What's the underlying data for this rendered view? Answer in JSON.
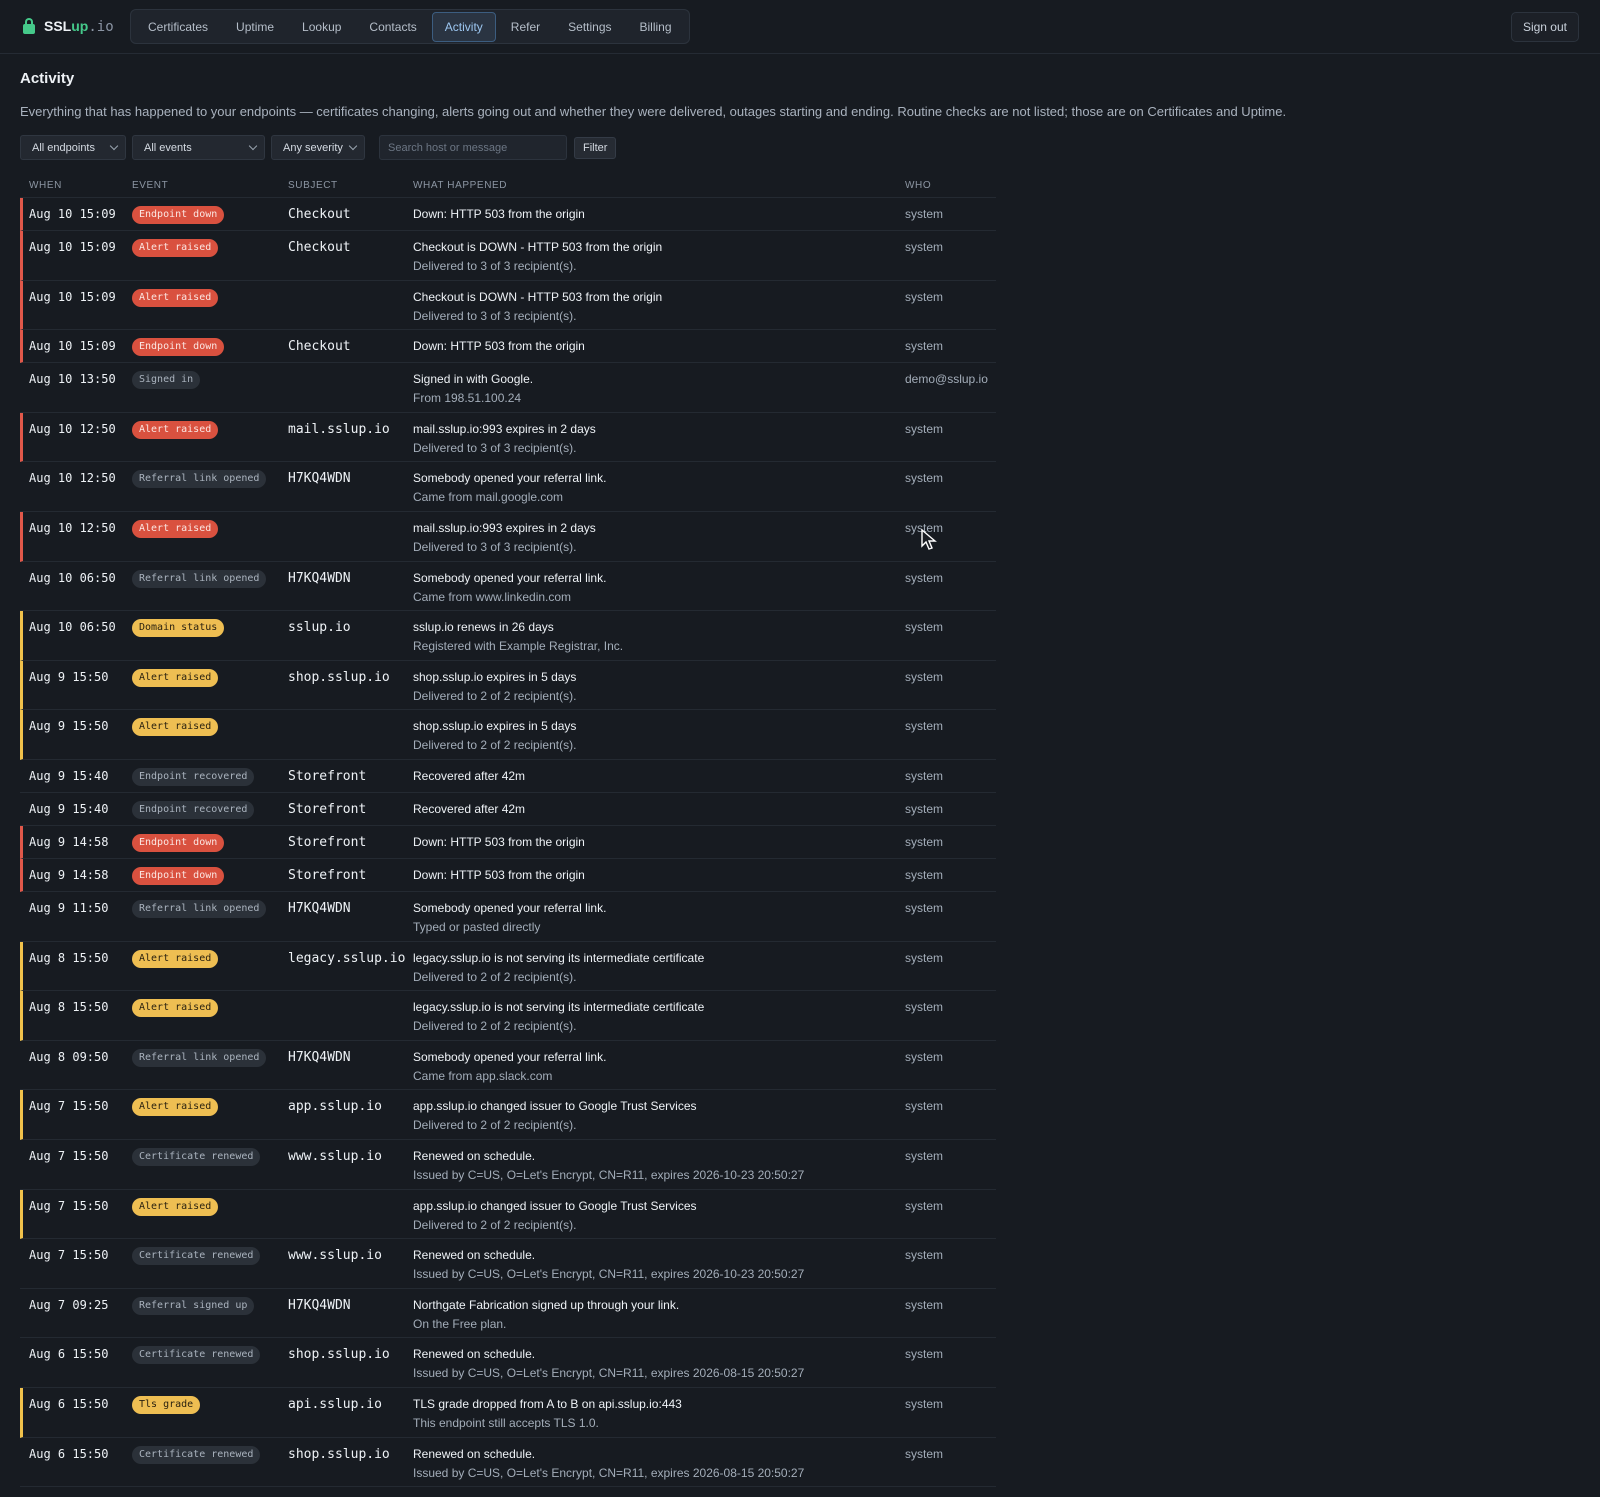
{
  "brand": {
    "name": "SSL",
    "accent": "up",
    "domain": ".io",
    "icon": "lock-icon",
    "accent_color": "#45c98a"
  },
  "nav": {
    "tabs": [
      "Certificates",
      "Uptime",
      "Lookup",
      "Contacts",
      "Activity",
      "Refer",
      "Settings",
      "Billing"
    ],
    "active": "Activity"
  },
  "sign_out": "Sign out",
  "page": {
    "title": "Activity",
    "description": "Everything that has happened to your endpoints — certificates changing, alerts going out and whether they were delivered, outages starting and ending. Routine checks are not listed; those are on Certificates and Uptime."
  },
  "filters": {
    "endpoints": "All endpoints",
    "events": "All events",
    "severity": "Any severity",
    "search_placeholder": "Search host or message",
    "search_value": "",
    "button": "Filter"
  },
  "columns": {
    "when": "WHEN",
    "event": "EVENT",
    "subject": "SUBJECT",
    "what": "WHAT HAPPENED",
    "who": "WHO"
  },
  "rows": [
    {
      "when": "Aug 10 15:09",
      "event": "Endpoint down",
      "tone": "red",
      "subject": "Checkout",
      "what": "Down: HTTP 503 from the origin",
      "detail": "",
      "who": "system"
    },
    {
      "when": "Aug 10 15:09",
      "event": "Alert raised",
      "tone": "red",
      "subject": "Checkout",
      "what": "Checkout is DOWN - HTTP 503 from the origin",
      "detail": "Delivered to 3 of 3 recipient(s).",
      "who": "system"
    },
    {
      "when": "Aug 10 15:09",
      "event": "Alert raised",
      "tone": "red",
      "subject": "",
      "what": "Checkout is DOWN - HTTP 503 from the origin",
      "detail": "Delivered to 3 of 3 recipient(s).",
      "who": "system"
    },
    {
      "when": "Aug 10 15:09",
      "event": "Endpoint down",
      "tone": "red",
      "subject": "Checkout",
      "what": "Down: HTTP 503 from the origin",
      "detail": "",
      "who": "system"
    },
    {
      "when": "Aug 10 13:50",
      "event": "Signed in",
      "tone": "gray",
      "subject": "",
      "what": "Signed in with Google.",
      "detail": "From 198.51.100.24",
      "who": "demo@sslup.io"
    },
    {
      "when": "Aug 10 12:50",
      "event": "Alert raised",
      "tone": "red",
      "subject": "mail.sslup.io",
      "what": "mail.sslup.io:993 expires in 2 days",
      "detail": "Delivered to 3 of 3 recipient(s).",
      "who": "system"
    },
    {
      "when": "Aug 10 12:50",
      "event": "Referral link opened",
      "tone": "gray",
      "subject": "H7KQ4WDN",
      "what": "Somebody opened your referral link.",
      "detail": "Came from mail.google.com",
      "who": "system"
    },
    {
      "when": "Aug 10 12:50",
      "event": "Alert raised",
      "tone": "red",
      "subject": "",
      "what": "mail.sslup.io:993 expires in 2 days",
      "detail": "Delivered to 3 of 3 recipient(s).",
      "who": "system"
    },
    {
      "when": "Aug 10 06:50",
      "event": "Referral link opened",
      "tone": "gray",
      "subject": "H7KQ4WDN",
      "what": "Somebody opened your referral link.",
      "detail": "Came from www.linkedin.com",
      "who": "system"
    },
    {
      "when": "Aug 10 06:50",
      "event": "Domain status",
      "tone": "yellow",
      "subject": "sslup.io",
      "what": "sslup.io renews in 26 days",
      "detail": "Registered with Example Registrar, Inc.",
      "who": "system"
    },
    {
      "when": "Aug 9 15:50",
      "event": "Alert raised",
      "tone": "yellow",
      "subject": "shop.sslup.io",
      "what": "shop.sslup.io expires in 5 days",
      "detail": "Delivered to 2 of 2 recipient(s).",
      "who": "system"
    },
    {
      "when": "Aug 9 15:50",
      "event": "Alert raised",
      "tone": "yellow",
      "subject": "",
      "what": "shop.sslup.io expires in 5 days",
      "detail": "Delivered to 2 of 2 recipient(s).",
      "who": "system"
    },
    {
      "when": "Aug 9 15:40",
      "event": "Endpoint recovered",
      "tone": "gray",
      "subject": "Storefront",
      "what": "Recovered after 42m",
      "detail": "",
      "who": "system"
    },
    {
      "when": "Aug 9 15:40",
      "event": "Endpoint recovered",
      "tone": "gray",
      "subject": "Storefront",
      "what": "Recovered after 42m",
      "detail": "",
      "who": "system"
    },
    {
      "when": "Aug 9 14:58",
      "event": "Endpoint down",
      "tone": "red",
      "subject": "Storefront",
      "what": "Down: HTTP 503 from the origin",
      "detail": "",
      "who": "system"
    },
    {
      "when": "Aug 9 14:58",
      "event": "Endpoint down",
      "tone": "red",
      "subject": "Storefront",
      "what": "Down: HTTP 503 from the origin",
      "detail": "",
      "who": "system"
    },
    {
      "when": "Aug 9 11:50",
      "event": "Referral link opened",
      "tone": "gray",
      "subject": "H7KQ4WDN",
      "what": "Somebody opened your referral link.",
      "detail": "Typed or pasted directly",
      "who": "system"
    },
    {
      "when": "Aug 8 15:50",
      "event": "Alert raised",
      "tone": "yellow",
      "subject": "legacy.sslup.io",
      "what": "legacy.sslup.io is not serving its intermediate certificate",
      "detail": "Delivered to 2 of 2 recipient(s).",
      "who": "system"
    },
    {
      "when": "Aug 8 15:50",
      "event": "Alert raised",
      "tone": "yellow",
      "subject": "",
      "what": "legacy.sslup.io is not serving its intermediate certificate",
      "detail": "Delivered to 2 of 2 recipient(s).",
      "who": "system"
    },
    {
      "when": "Aug 8 09:50",
      "event": "Referral link opened",
      "tone": "gray",
      "subject": "H7KQ4WDN",
      "what": "Somebody opened your referral link.",
      "detail": "Came from app.slack.com",
      "who": "system"
    },
    {
      "when": "Aug 7 15:50",
      "event": "Alert raised",
      "tone": "yellow",
      "subject": "app.sslup.io",
      "what": "app.sslup.io changed issuer to Google Trust Services",
      "detail": "Delivered to 2 of 2 recipient(s).",
      "who": "system"
    },
    {
      "when": "Aug 7 15:50",
      "event": "Certificate renewed",
      "tone": "gray",
      "subject": "www.sslup.io",
      "what": "Renewed on schedule.",
      "detail": "Issued by C=US, O=Let's Encrypt, CN=R11, expires 2026-10-23 20:50:27",
      "who": "system"
    },
    {
      "when": "Aug 7 15:50",
      "event": "Alert raised",
      "tone": "yellow",
      "subject": "",
      "what": "app.sslup.io changed issuer to Google Trust Services",
      "detail": "Delivered to 2 of 2 recipient(s).",
      "who": "system"
    },
    {
      "when": "Aug 7 15:50",
      "event": "Certificate renewed",
      "tone": "gray",
      "subject": "www.sslup.io",
      "what": "Renewed on schedule.",
      "detail": "Issued by C=US, O=Let's Encrypt, CN=R11, expires 2026-10-23 20:50:27",
      "who": "system"
    },
    {
      "when": "Aug 7 09:25",
      "event": "Referral signed up",
      "tone": "gray",
      "subject": "H7KQ4WDN",
      "what": "Northgate Fabrication signed up through your link.",
      "detail": "On the Free plan.",
      "who": "system"
    },
    {
      "when": "Aug 6 15:50",
      "event": "Certificate renewed",
      "tone": "gray",
      "subject": "shop.sslup.io",
      "what": "Renewed on schedule.",
      "detail": "Issued by C=US, O=Let's Encrypt, CN=R11, expires 2026-08-15 20:50:27",
      "who": "system"
    },
    {
      "when": "Aug 6 15:50",
      "event": "Tls grade",
      "tone": "yellow",
      "subject": "api.sslup.io",
      "what": "TLS grade dropped from A to B on api.sslup.io:443",
      "detail": "This endpoint still accepts TLS 1.0.",
      "who": "system"
    },
    {
      "when": "Aug 6 15:50",
      "event": "Certificate renewed",
      "tone": "gray",
      "subject": "shop.sslup.io",
      "what": "Renewed on schedule.",
      "detail": "Issued by C=US, O=Let's Encrypt, CN=R11, expires 2026-08-15 20:50:27",
      "who": "system"
    }
  ],
  "colors": {
    "red": "#d9513f",
    "yellow": "#eebe52",
    "gray": "#2b3139",
    "background": "#171b21"
  }
}
